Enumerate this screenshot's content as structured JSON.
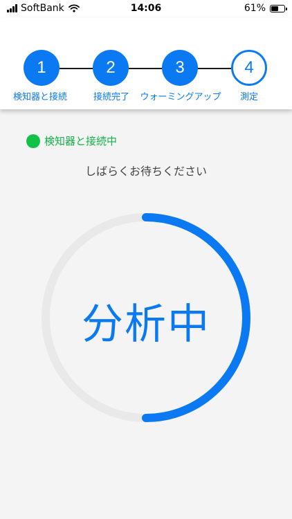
{
  "status_bar": {
    "carrier": "SoftBank",
    "time": "14:06",
    "battery_percent": "61%",
    "battery_level": 0.61
  },
  "steps": [
    {
      "number": "1",
      "label": "検知器と接続",
      "state": "done"
    },
    {
      "number": "2",
      "label": "接続完了",
      "state": "done"
    },
    {
      "number": "3",
      "label": "ウォーミングアップ",
      "state": "done"
    },
    {
      "number": "4",
      "label": "測定",
      "state": "current"
    }
  ],
  "connection": {
    "status_text": "検知器と接続中",
    "status_color": "#12c247"
  },
  "wait_message": "しばらくお待ちください",
  "progress": {
    "label": "分析中",
    "fraction": 0.5
  },
  "colors": {
    "accent": "#0a79f2",
    "track": "#e9e9e9",
    "background": "#f4f4f4"
  }
}
